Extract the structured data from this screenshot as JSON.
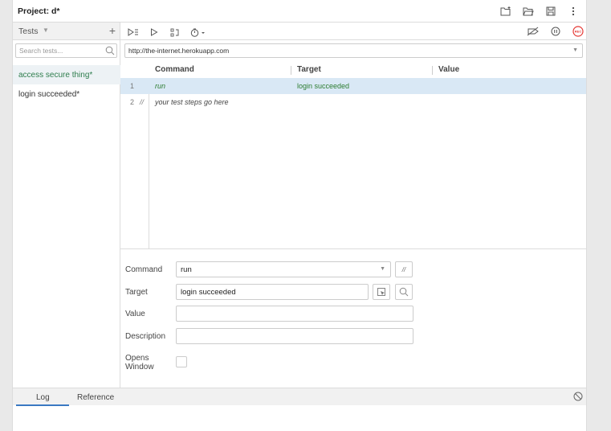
{
  "project": {
    "title": "Project:  d*"
  },
  "sidebar": {
    "title": "Tests",
    "search_placeholder": "Search tests...",
    "items": [
      {
        "label": "access secure thing*",
        "active": true
      },
      {
        "label": "login succeeded*",
        "active": false
      }
    ]
  },
  "url": {
    "value": "http://the-internet.herokuapp.com"
  },
  "table": {
    "columns": [
      "Command",
      "Target",
      "Value"
    ],
    "rows": [
      {
        "num": "1",
        "command": "run",
        "target": "login succeeded",
        "value": ""
      },
      {
        "num": "2",
        "comment": "//",
        "command": "your test steps go here",
        "target": "",
        "value": ""
      }
    ]
  },
  "editor": {
    "command_label": "Command",
    "command_value": "run",
    "comment_button": "//",
    "target_label": "Target",
    "target_value": "login succeeded",
    "value_label": "Value",
    "value_value": "",
    "description_label": "Description",
    "description_value": "",
    "opens_window_label_1": "Opens",
    "opens_window_label_2": "Window"
  },
  "bottom": {
    "tabs": [
      "Log",
      "Reference"
    ]
  },
  "colors": {
    "accent_green": "#2e7d32",
    "selected_row": "#d9e8f5",
    "rec_red": "#e53935"
  }
}
